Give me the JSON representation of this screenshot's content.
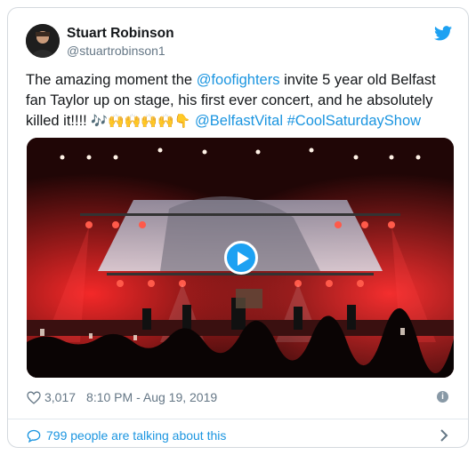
{
  "tweet": {
    "name": "Stuart Robinson",
    "handle": "@stuartrobinson1",
    "text_1": "The amazing moment the ",
    "mention": "@foofighters",
    "text_2": " invite 5 year old Belfast fan Taylor up on stage, his first ever concert, and he absolutely killed it!!!! ",
    "emojis": "🎶🙌🙌🙌🙌👇",
    "tag_1": "@BelfastVital",
    "tag_2": "#CoolSaturdayShow",
    "likes": "3,017",
    "timestamp": "8:10 PM - Aug 19, 2019",
    "talking": "799 people are talking about this"
  },
  "colors": {
    "link": "#1b95e0",
    "play": "#1da1f2",
    "muted": "#657786"
  },
  "icons": {
    "bird": "twitter-bird-icon",
    "heart": "heart-icon",
    "info": "info-icon",
    "bubble": "speech-bubble-icon",
    "chevron": "chevron-right-icon",
    "play": "play-icon"
  }
}
